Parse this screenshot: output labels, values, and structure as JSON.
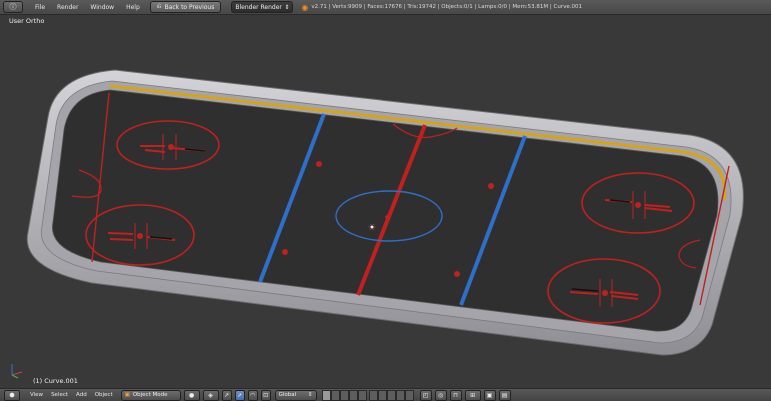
{
  "header": {
    "editor_icon": "info-editor-icon",
    "menus": [
      "File",
      "Render",
      "Window",
      "Help"
    ],
    "back_button": "Back to Previous",
    "render_engine": "Blender Render",
    "stats": "v2.71 | Verts:9909 | Faces:17676 | Tris:19742 | Objects:0/1 | Lamps:0/0 | Mem:53.81M | Curve.001"
  },
  "viewport": {
    "view_name": "User Ortho",
    "object_name": "(1) Curve.001"
  },
  "footer": {
    "menus": [
      "View",
      "Select",
      "Add",
      "Object"
    ],
    "mode": "Object Mode",
    "orientation": "Global"
  },
  "colors": {
    "background": "#393939",
    "red_line": "#c0211f",
    "blue_line": "#2e6fc8",
    "board": "#d6a418",
    "rink_floor": "#2f2f2f",
    "wall": "#b9b9bd"
  }
}
